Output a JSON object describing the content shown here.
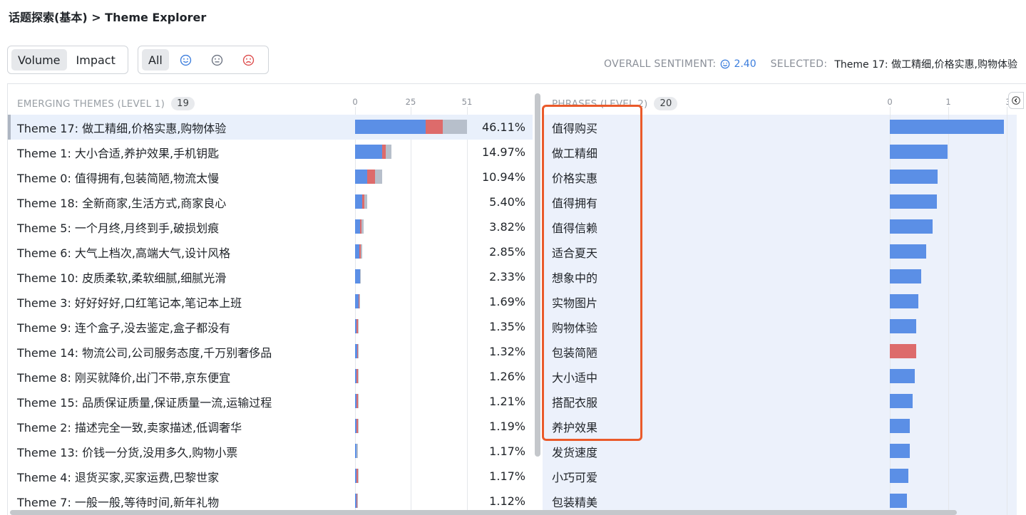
{
  "breadcrumb": "话题探索(基本) > Theme Explorer",
  "metric_toggle": {
    "volume": "Volume",
    "impact": "Impact",
    "selected": "Volume"
  },
  "sentiment_filter": {
    "all": "All",
    "icons": [
      "smile-icon",
      "neutral-face-icon",
      "frown-icon"
    ],
    "selected": "All"
  },
  "overall": {
    "label": "OVERALL SENTIMENT:",
    "score": "2.40",
    "selected_label": "SELECTED:",
    "selected_value": "Theme 17: 做工精细,价格实惠,购物体验"
  },
  "colors": {
    "positive": "#5b8fe6",
    "negative": "#dd6b6b",
    "neutral": "#b7bfcb",
    "accent": "#3b7ddd",
    "highlight": "#ea5a2a"
  },
  "left_panel": {
    "title": "EMERGING THEMES (LEVEL 1)",
    "count": "19",
    "axis_ticks": [
      "0",
      "25",
      "51"
    ],
    "axis_max": 51
  },
  "right_panel": {
    "title": "PHRASES (LEVEL 2)",
    "count": "20",
    "axis_ticks": [
      "0",
      "1",
      "3"
    ],
    "axis_max": 3
  },
  "chart_data": [
    {
      "type": "bar",
      "title": "EMERGING THEMES (LEVEL 1)",
      "stacked": true,
      "xlim": [
        0,
        51
      ],
      "categories": [
        "Theme 17: 做工精细,价格实惠,购物体验",
        "Theme 1: 大小合适,养护效果,手机钥匙",
        "Theme 0: 值得拥有,包装简陋,物流太慢",
        "Theme 18: 全新商家,生活方式,商家良心",
        "Theme 5: 一个月终,月终到手,破损划痕",
        "Theme 6: 大气上档次,高端大气,设计风格",
        "Theme 10: 皮质柔软,柔软细腻,细腻光滑",
        "Theme 3: 好好好好,口红笔记本,笔记本上班",
        "Theme 9: 连个盒子,没去鉴定,盒子都没有",
        "Theme 14: 物流公司,公司服务态度,千万别奢侈品",
        "Theme 8: 刚买就降价,出门不带,京东便宜",
        "Theme 15: 品质保证质量,保证质量一流,运输过程",
        "Theme 2: 描述完全一致,卖家描述,低调奢华",
        "Theme 13: 价钱一分货,没用多久,购物小票",
        "Theme 4: 退货买家,买家运费,巴黎世家",
        "Theme 7: 一般一般,等待时间,新年礼物"
      ],
      "percentages": [
        "46.11%",
        "14.97%",
        "10.94%",
        "5.40%",
        "3.82%",
        "2.85%",
        "2.33%",
        "1.69%",
        "1.35%",
        "1.32%",
        "1.26%",
        "1.21%",
        "1.19%",
        "1.17%",
        "1.17%",
        "1.12%"
      ],
      "series": [
        {
          "name": "positive",
          "values": [
            32,
            12.5,
            5.5,
            3.2,
            2.2,
            2.0,
            2.4,
            1.6,
            0.6,
            0.9,
            0.6,
            0.6,
            0.6,
            0.6,
            0.6,
            0.5
          ]
        },
        {
          "name": "negative",
          "values": [
            8,
            1.5,
            3.5,
            1.0,
            0.6,
            0.5,
            0.0,
            0.3,
            0.6,
            0.4,
            0.6,
            0.6,
            0.6,
            0.0,
            0.6,
            0.6
          ]
        },
        {
          "name": "neutral",
          "values": [
            11,
            2.5,
            3.5,
            1.3,
            1.0,
            0.8,
            0.3,
            0.2,
            0.3,
            0.2,
            0.2,
            0.2,
            0.2,
            0.6,
            0.2,
            0.2
          ]
        }
      ]
    },
    {
      "type": "bar",
      "title": "PHRASES (LEVEL 2)",
      "xlim": [
        0,
        3
      ],
      "categories": [
        "值得购买",
        "做工精细",
        "价格实惠",
        "值得拥有",
        "值得信赖",
        "适合夏天",
        "想象中的",
        "实物图片",
        "购物体验",
        "包装简陋",
        "大小适中",
        "搭配衣服",
        "养护效果",
        "发货速度",
        "小巧可爱",
        "包装精美"
      ],
      "values": [
        2.9,
        1.47,
        1.21,
        1.19,
        1.09,
        0.92,
        0.8,
        0.72,
        0.66,
        0.66,
        0.63,
        0.58,
        0.51,
        0.5,
        0.47,
        0.44
      ],
      "bar_colors": [
        "#5b8fe6",
        "#5b8fe6",
        "#5b8fe6",
        "#5b8fe6",
        "#5b8fe6",
        "#5b8fe6",
        "#5b8fe6",
        "#5b8fe6",
        "#5b8fe6",
        "#dd6b6b",
        "#5b8fe6",
        "#5b8fe6",
        "#5b8fe6",
        "#5b8fe6",
        "#5b8fe6",
        "#5b8fe6"
      ]
    }
  ]
}
